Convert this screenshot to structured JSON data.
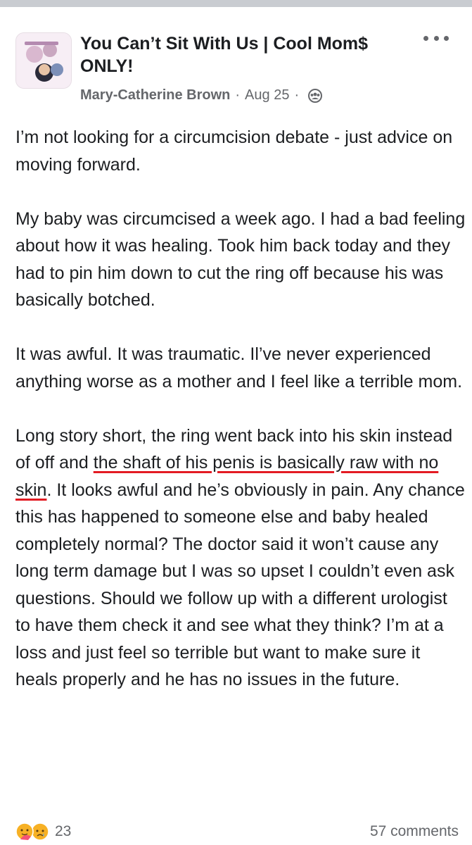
{
  "group": {
    "name": "You Can’t Sit With Us | Cool Mom$ ONLY!"
  },
  "post": {
    "author": "Mary-Catherine Brown",
    "separator": "·",
    "date": "Aug 25",
    "audience_icon": "group-audience-icon",
    "paragraphs": {
      "p1": "I’m not looking for a circumcision debate - just advice on moving forward.",
      "p2": "My baby was circumcised a week ago. I had a bad feeling about how it was healing. Took him back today and they had to pin him down to cut the ring off because his was basically botched.",
      "p3": "It was awful. It was traumatic. Il’ve never experienced anything worse as a mother and I feel like a terrible mom.",
      "p4_before": "Long story short, the ring went back into his skin instead of off and ",
      "p4_highlight": "the shaft of his penis is basically raw with no skin",
      "p4_after": ". It looks awful and he’s obviously in pain. Any chance this has happened to someone else and baby healed completely normal? The doctor said it won’t cause any long term damage but I was so upset I couldn’t even ask questions. Should we follow up with a different urologist to have them check it and see what they think? I’m at a loss and just feel so terrible but want to make sure it heals properly and he has no issues in the future."
    }
  },
  "footer": {
    "reaction_count": "23",
    "comments": "57 comments",
    "reaction_icons": [
      "care-reaction-icon",
      "sad-reaction-icon"
    ]
  },
  "colors": {
    "highlight_underline": "#e31b23",
    "meta_text": "#65676b"
  }
}
